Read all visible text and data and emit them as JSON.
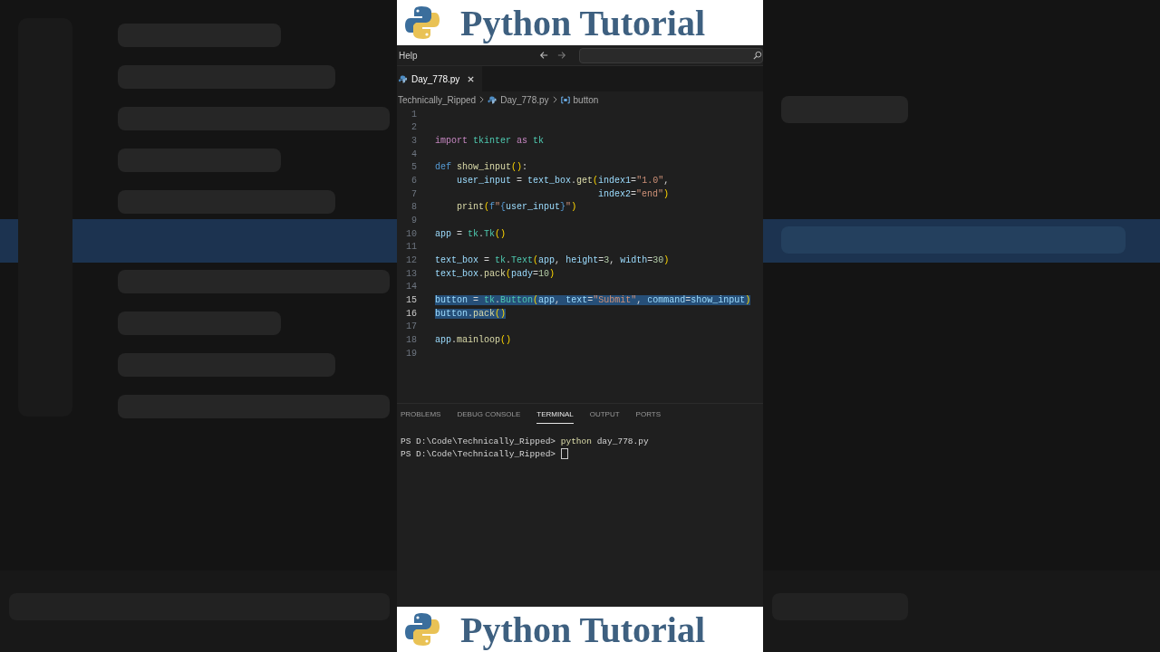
{
  "banner_top": {
    "title": "Python Tutorial"
  },
  "title_bar": {
    "menu": "Help"
  },
  "tabs": [
    {
      "label": "Day_778.py",
      "selected": true
    }
  ],
  "breadcrumb": [
    "Technically_Ripped",
    "Day_778.py",
    "button"
  ],
  "code_lines": [
    {
      "n": "1",
      "selected": false
    },
    {
      "n": "2",
      "selected": false
    },
    {
      "n": "3",
      "selected": false,
      "tokens": [
        {
          "t": "import ",
          "kind": "kw"
        },
        {
          "t": "tkinter ",
          "kind": "cls"
        },
        {
          "t": "as ",
          "kind": "kw"
        },
        {
          "t": "tk",
          "kind": "cls"
        }
      ]
    },
    {
      "n": "4",
      "selected": false
    },
    {
      "n": "5",
      "selected": false,
      "tokens": [
        {
          "t": "def ",
          "kind": "def"
        },
        {
          "t": "show_input",
          "kind": "fn"
        },
        {
          "t": "()",
          "kind": "paren"
        },
        {
          "t": ":",
          "kind": "plain"
        }
      ]
    },
    {
      "n": "6",
      "selected": false,
      "tokens": [
        {
          "t": "    user_input",
          "kind": "var"
        },
        {
          "t": " = ",
          "kind": "plain"
        },
        {
          "t": "text_box",
          "kind": "var"
        },
        {
          "t": ".",
          "kind": "plain"
        },
        {
          "t": "get",
          "kind": "fn"
        },
        {
          "t": "(",
          "kind": "paren"
        },
        {
          "t": "index1",
          "kind": "var"
        },
        {
          "t": "=",
          "kind": "plain"
        },
        {
          "t": "\"1.0\"",
          "kind": "str"
        },
        {
          "t": ",",
          "kind": "plain"
        }
      ]
    },
    {
      "n": "7",
      "selected": false,
      "tokens": [
        {
          "t": "                              index2",
          "kind": "var"
        },
        {
          "t": "=",
          "kind": "plain"
        },
        {
          "t": "\"end\"",
          "kind": "str"
        },
        {
          "t": ")",
          "kind": "paren"
        }
      ]
    },
    {
      "n": "8",
      "selected": false,
      "tokens": [
        {
          "t": "    print",
          "kind": "fn"
        },
        {
          "t": "(",
          "kind": "paren"
        },
        {
          "t": "f",
          "kind": "def"
        },
        {
          "t": "\"",
          "kind": "str"
        },
        {
          "t": "{",
          "kind": "def"
        },
        {
          "t": "user_input",
          "kind": "var"
        },
        {
          "t": "}",
          "kind": "def"
        },
        {
          "t": "\"",
          "kind": "str"
        },
        {
          "t": ")",
          "kind": "paren"
        }
      ]
    },
    {
      "n": "9",
      "selected": false
    },
    {
      "n": "10",
      "selected": false,
      "tokens": [
        {
          "t": "app",
          "kind": "var"
        },
        {
          "t": " = ",
          "kind": "plain"
        },
        {
          "t": "tk",
          "kind": "cls"
        },
        {
          "t": ".",
          "kind": "plain"
        },
        {
          "t": "Tk",
          "kind": "cls"
        },
        {
          "t": "()",
          "kind": "paren"
        }
      ]
    },
    {
      "n": "11",
      "selected": false
    },
    {
      "n": "12",
      "selected": false,
      "tokens": [
        {
          "t": "text_box",
          "kind": "var"
        },
        {
          "t": " = ",
          "kind": "plain"
        },
        {
          "t": "tk",
          "kind": "cls"
        },
        {
          "t": ".",
          "kind": "plain"
        },
        {
          "t": "Text",
          "kind": "cls"
        },
        {
          "t": "(",
          "kind": "paren"
        },
        {
          "t": "app",
          "kind": "var"
        },
        {
          "t": ", ",
          "kind": "plain"
        },
        {
          "t": "height",
          "kind": "var"
        },
        {
          "t": "=",
          "kind": "plain"
        },
        {
          "t": "3",
          "kind": "num"
        },
        {
          "t": ", ",
          "kind": "plain"
        },
        {
          "t": "width",
          "kind": "var"
        },
        {
          "t": "=",
          "kind": "plain"
        },
        {
          "t": "30",
          "kind": "num"
        },
        {
          "t": ")",
          "kind": "paren"
        }
      ]
    },
    {
      "n": "13",
      "selected": false,
      "tokens": [
        {
          "t": "text_box",
          "kind": "var"
        },
        {
          "t": ".",
          "kind": "plain"
        },
        {
          "t": "pack",
          "kind": "fn"
        },
        {
          "t": "(",
          "kind": "paren"
        },
        {
          "t": "pady",
          "kind": "var"
        },
        {
          "t": "=",
          "kind": "plain"
        },
        {
          "t": "10",
          "kind": "num"
        },
        {
          "t": ")",
          "kind": "paren"
        }
      ]
    },
    {
      "n": "14",
      "selected": false
    },
    {
      "n": "15",
      "selected": true,
      "tokens": [
        {
          "t": "button",
          "kind": "var"
        },
        {
          "t": " = ",
          "kind": "plain"
        },
        {
          "t": "tk",
          "kind": "cls"
        },
        {
          "t": ".",
          "kind": "plain"
        },
        {
          "t": "Button",
          "kind": "cls"
        },
        {
          "t": "(",
          "kind": "paren"
        },
        {
          "t": "app",
          "kind": "var"
        },
        {
          "t": ", ",
          "kind": "plain"
        },
        {
          "t": "text",
          "kind": "var"
        },
        {
          "t": "=",
          "kind": "plain"
        },
        {
          "t": "\"Submit\"",
          "kind": "str"
        },
        {
          "t": ", ",
          "kind": "plain"
        },
        {
          "t": "command",
          "kind": "var"
        },
        {
          "t": "=",
          "kind": "plain"
        },
        {
          "t": "show_input",
          "kind": "var"
        },
        {
          "t": ")",
          "kind": "paren"
        }
      ]
    },
    {
      "n": "16",
      "selected": true,
      "tokens": [
        {
          "t": "button",
          "kind": "var"
        },
        {
          "t": ".",
          "kind": "plain"
        },
        {
          "t": "pack",
          "kind": "fn"
        },
        {
          "t": "()",
          "kind": "paren"
        }
      ]
    },
    {
      "n": "17",
      "selected": false
    },
    {
      "n": "18",
      "selected": false,
      "tokens": [
        {
          "t": "app",
          "kind": "var"
        },
        {
          "t": ".",
          "kind": "plain"
        },
        {
          "t": "mainloop",
          "kind": "fn"
        },
        {
          "t": "()",
          "kind": "paren"
        }
      ]
    },
    {
      "n": "19",
      "selected": false
    }
  ],
  "panel_tabs": [
    {
      "label": "PROBLEMS",
      "selected": false
    },
    {
      "label": "DEBUG CONSOLE",
      "selected": false
    },
    {
      "label": "TERMINAL",
      "selected": true
    },
    {
      "label": "OUTPUT",
      "selected": false
    },
    {
      "label": "PORTS",
      "selected": false
    }
  ],
  "terminal_lines": [
    {
      "cursor": false,
      "tokens": [
        {
          "t": "PS D:\\Code\\Technically_Ripped> ",
          "kind": "plain"
        },
        {
          "t": "python",
          "kind": "fn"
        },
        {
          "t": " day_778.py",
          "kind": "plain"
        }
      ]
    },
    {
      "cursor": true,
      "tokens": [
        {
          "t": "PS D:\\Code\\Technically_Ripped> ",
          "kind": "plain"
        }
      ]
    }
  ],
  "banner_bottom": {
    "title": "Python Tutorial"
  }
}
